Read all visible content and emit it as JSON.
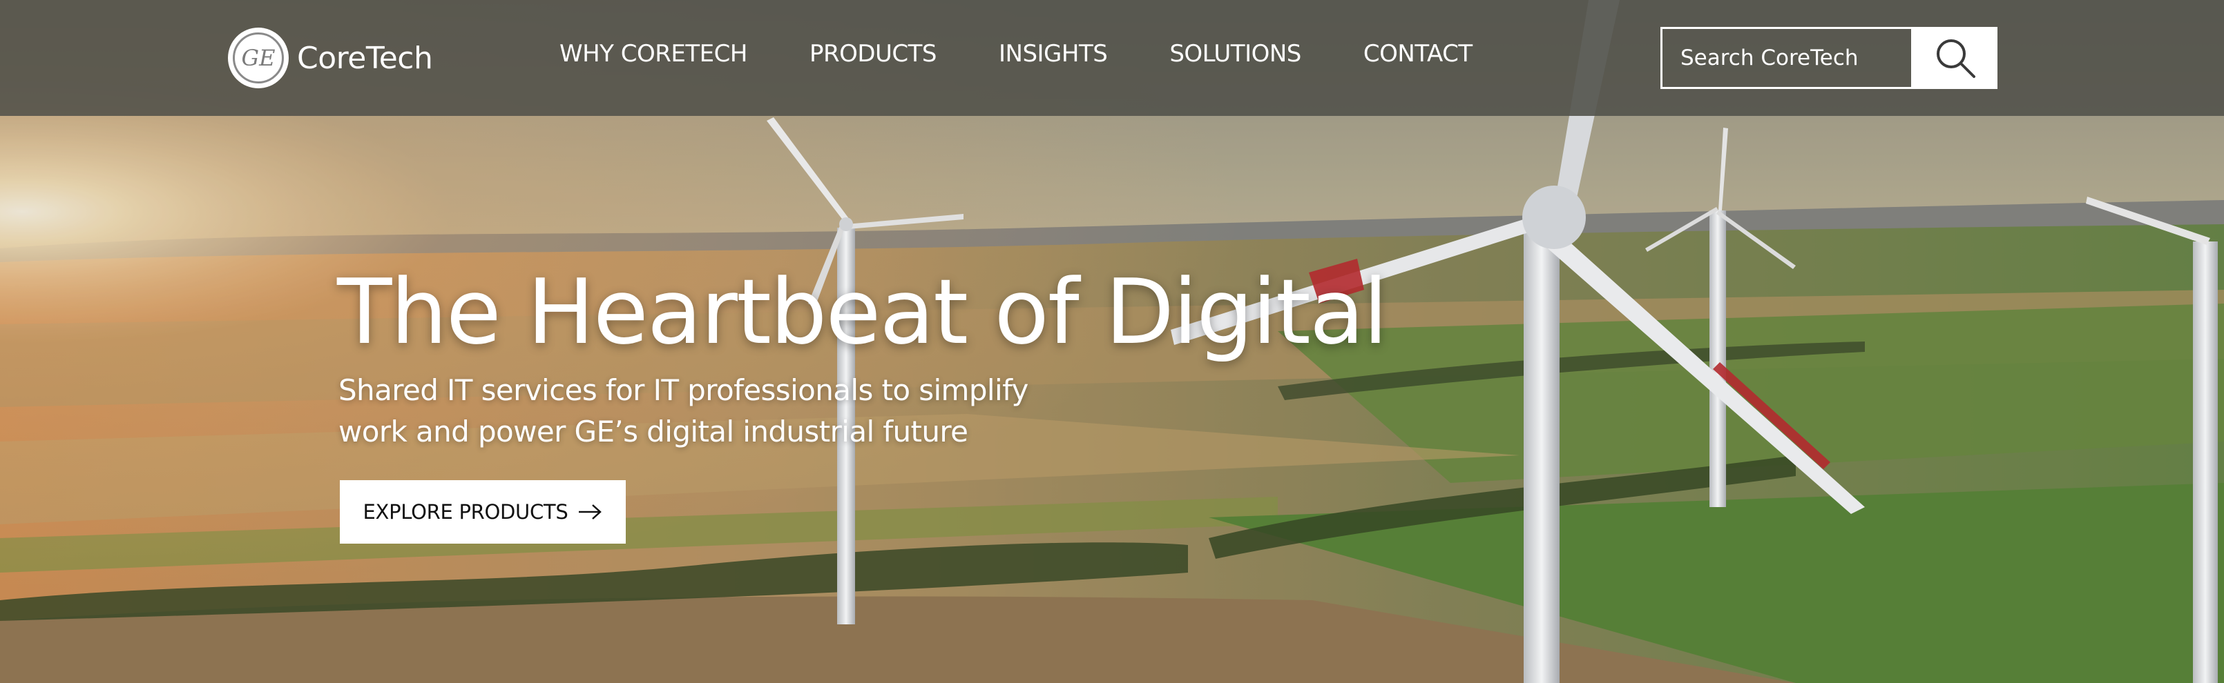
{
  "brand": {
    "name": "CoreTech",
    "logo_mark": "GE",
    "logo_icon": "ge-monogram-logo"
  },
  "nav": {
    "items": [
      {
        "label": "WHY CORETECH"
      },
      {
        "label": "PRODUCTS"
      },
      {
        "label": "INSIGHTS"
      },
      {
        "label": "SOLUTIONS"
      },
      {
        "label": "CONTACT"
      }
    ]
  },
  "search": {
    "placeholder": "Search CoreTech",
    "value": "",
    "icon": "search-icon"
  },
  "hero": {
    "title": "The Heartbeat of Digital",
    "subtitle": "Shared IT services for IT professionals to simplify work and power GE’s digital industrial future",
    "cta_label": "EXPLORE PRODUCTS",
    "cta_icon": "arrow-right-icon",
    "background": "wind-farm-photo"
  },
  "colors": {
    "nav_bg": "#4e4e48",
    "text": "#ffffff",
    "cta_bg": "#ffffff",
    "cta_text": "#111111"
  }
}
